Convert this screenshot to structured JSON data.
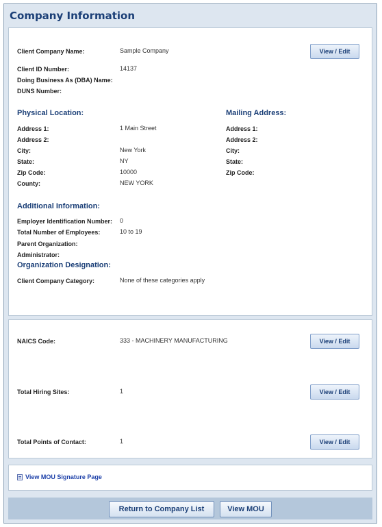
{
  "title": "Company Information",
  "company": {
    "client_company_name_label": "Client Company Name:",
    "client_company_name": "Sample Company",
    "client_id_label": "Client ID Number:",
    "client_id": "14137",
    "dba_label": "Doing Business As (DBA) Name:",
    "duns_label": "DUNS Number:",
    "edit_button": "View / Edit"
  },
  "physical": {
    "heading": "Physical Location:",
    "address1_label": "Address 1:",
    "address1": "1 Main Street",
    "address2_label": "Address 2:",
    "city_label": "City:",
    "city": "New York",
    "state_label": "State:",
    "state": "NY",
    "zip_label": "Zip Code:",
    "zip": "10000",
    "county_label": "County:",
    "county": "NEW YORK"
  },
  "mailing": {
    "heading": "Mailing Address:",
    "address1_label": "Address 1:",
    "address2_label": "Address 2:",
    "city_label": "City:",
    "state_label": "State:",
    "zip_label": "Zip Code:"
  },
  "additional": {
    "heading": "Additional Information:",
    "ein_label": "Employer Identification Number:",
    "ein": "0",
    "employees_label": "Total Number of Employees:",
    "employees": "10 to 19",
    "parent_label": "Parent Organization:",
    "admin_label": "Administrator:"
  },
  "designation": {
    "heading": "Organization Designation:",
    "category_label": "Client Company Category:",
    "category": "None of these categories apply"
  },
  "details": {
    "naics_label": "NAICS Code:",
    "naics": "333 - MACHINERY MANUFACTURING",
    "hiring_label": "Total Hiring Sites:",
    "hiring": "1",
    "contacts_label": "Total Points of Contact:",
    "contacts": "1",
    "edit_button": "View / Edit"
  },
  "mou": {
    "icon": "document-icon",
    "link": "View MOU Signature Page"
  },
  "footer": {
    "return_button": "Return to Company List",
    "view_mou_button": "View MOU"
  },
  "colors": {
    "heading": "#1b3f77",
    "background": "#dde6f0",
    "bar": "#b4c7db"
  }
}
